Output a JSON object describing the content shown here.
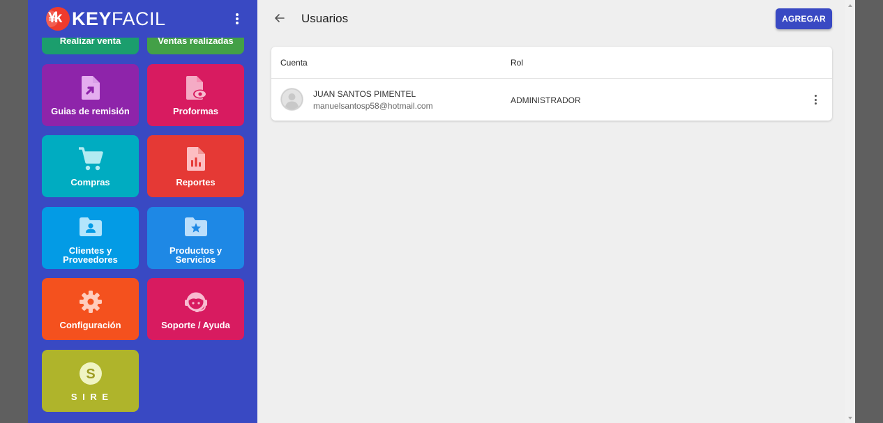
{
  "sidebar": {
    "logo_bold": "KEY",
    "logo_light": "FACIL",
    "tiles": [
      {
        "label": "Realizar venta",
        "color": "#1b9e6d"
      },
      {
        "label": "Ventas realizadas",
        "color": "#43a047"
      },
      {
        "label": "Guias de remisión",
        "color": "#8e24aa",
        "icon": "file-share-icon"
      },
      {
        "label": "Proformas",
        "color": "#d81b60",
        "icon": "file-eye-icon"
      },
      {
        "label": "Compras",
        "color": "#00acc1",
        "icon": "cart-icon"
      },
      {
        "label": "Reportes",
        "color": "#e53935",
        "icon": "file-chart-icon"
      },
      {
        "label": "Clientes y Proveedores",
        "color": "#039be5",
        "icon": "folder-person-icon"
      },
      {
        "label": "Productos y Servicios",
        "color": "#1e88e5",
        "icon": "folder-star-icon"
      },
      {
        "label": "Configuración",
        "color": "#f4511e",
        "icon": "gear-icon"
      },
      {
        "label": "Soporte / Ayuda",
        "color": "#d81b60",
        "icon": "support-agent-icon"
      },
      {
        "label": "S I R E",
        "color": "#afb42b",
        "icon": "sire-coin-icon"
      }
    ]
  },
  "header": {
    "title": "Usuarios",
    "add_button": "AGREGAR"
  },
  "table": {
    "columns": [
      "Cuenta",
      "Rol"
    ],
    "rows": [
      {
        "name": "JUAN SANTOS PIMENTEL",
        "email": "manuelsantosp58@hotmail.com",
        "role": "ADMINISTRADOR"
      }
    ]
  },
  "colors": {
    "primary": "#3949c3",
    "background": "#efefef"
  }
}
